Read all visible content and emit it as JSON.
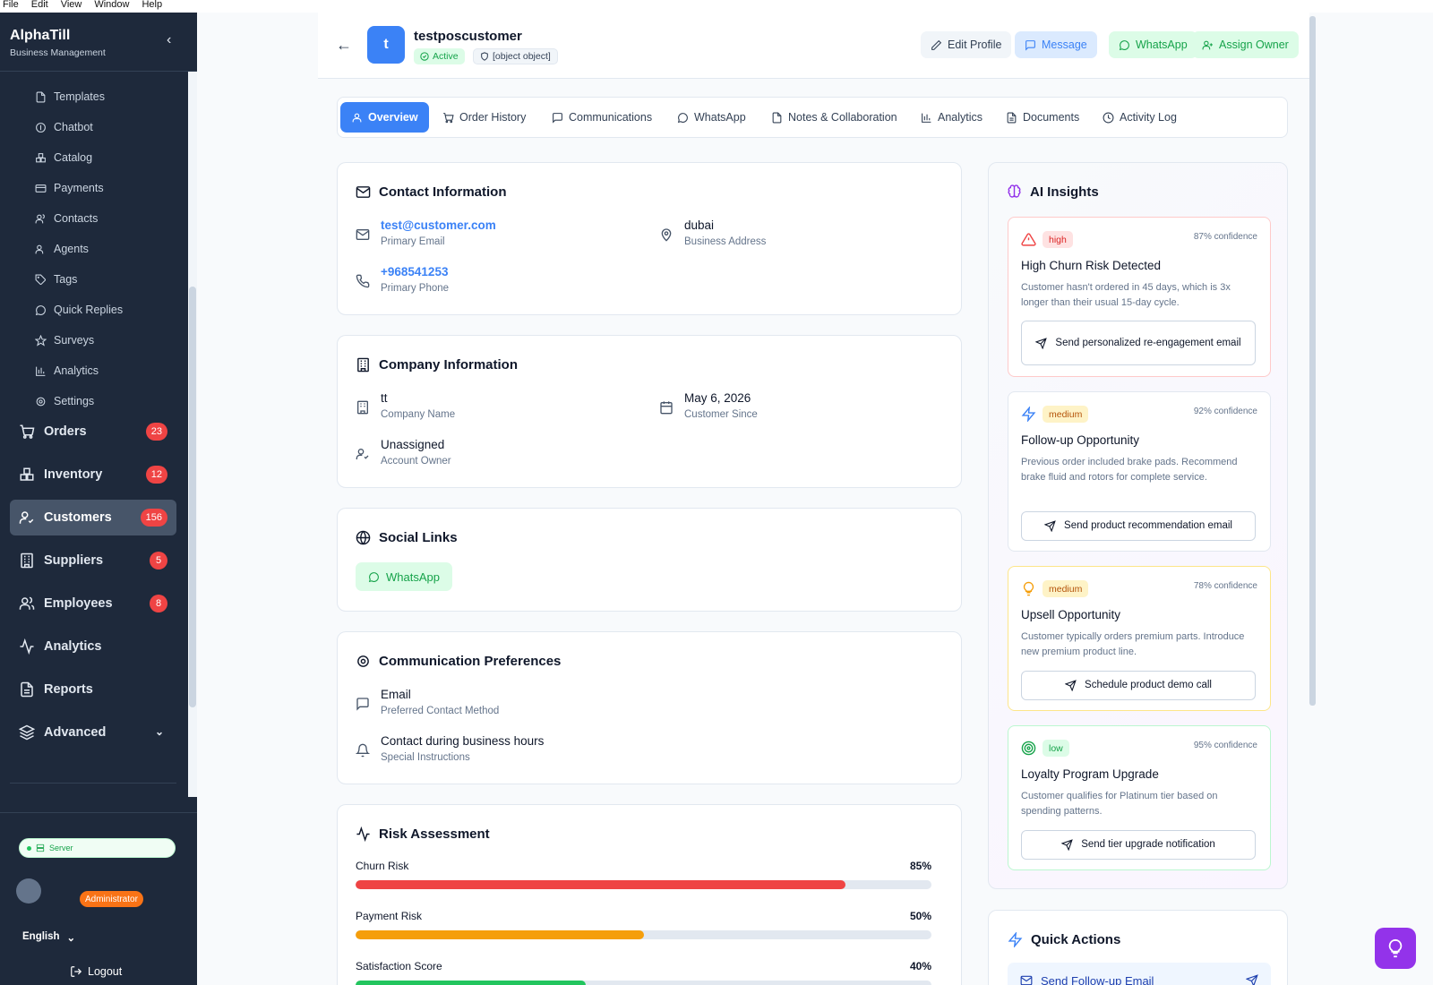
{
  "menubar": [
    "File",
    "Edit",
    "View",
    "Window",
    "Help"
  ],
  "sidebar": {
    "brand": "AlphaTill",
    "subtitle": "Business Management",
    "sub_items": [
      "Templates",
      "Chatbot",
      "Catalog",
      "Payments",
      "Contacts",
      "Agents",
      "Tags",
      "Quick Replies",
      "Surveys",
      "Analytics",
      "Settings"
    ],
    "main_items": [
      {
        "label": "Orders",
        "badge": "23"
      },
      {
        "label": "Inventory",
        "badge": "12"
      },
      {
        "label": "Customers",
        "badge": "156"
      },
      {
        "label": "Suppliers",
        "badge": "5"
      },
      {
        "label": "Employees",
        "badge": "8"
      },
      {
        "label": "Analytics"
      },
      {
        "label": "Reports"
      },
      {
        "label": "Advanced"
      }
    ],
    "server": "Server",
    "role": "Administrator",
    "language": "English",
    "logout": "Logout"
  },
  "header": {
    "avatar_letter": "t",
    "name": "testposcustomer",
    "status": "Active",
    "tag": "[object object]",
    "buttons": {
      "edit": "Edit Profile",
      "message": "Message",
      "whatsapp": "WhatsApp",
      "assign": "Assign Owner"
    }
  },
  "tabs": [
    "Overview",
    "Order History",
    "Communications",
    "WhatsApp",
    "Notes & Collaboration",
    "Analytics",
    "Documents",
    "Activity Log"
  ],
  "contact": {
    "title": "Contact Information",
    "email": "test@customer.com",
    "email_label": "Primary Email",
    "address": "dubai",
    "address_label": "Business Address",
    "phone": "+968541253",
    "phone_label": "Primary Phone"
  },
  "company": {
    "title": "Company Information",
    "name": "tt",
    "name_label": "Company Name",
    "since": "May 6, 2026",
    "since_label": "Customer Since",
    "owner": "Unassigned",
    "owner_label": "Account Owner"
  },
  "social": {
    "title": "Social Links",
    "whatsapp": "WhatsApp"
  },
  "prefs": {
    "title": "Communication Preferences",
    "method": "Email",
    "method_label": "Preferred Contact Method",
    "instructions": "Contact during business hours",
    "instructions_label": "Special Instructions"
  },
  "risk": {
    "title": "Risk Assessment",
    "rows": [
      {
        "label": "Churn Risk",
        "pct": "85%",
        "value": 0.85,
        "color": "#ef4444"
      },
      {
        "label": "Payment Risk",
        "pct": "50%",
        "value": 0.5,
        "color": "#f59e0b"
      },
      {
        "label": "Satisfaction Score",
        "pct": "40%",
        "value": 0.4,
        "color": "#22c55e"
      }
    ]
  },
  "ai": {
    "title": "AI Insights",
    "insights": [
      {
        "priority": "high",
        "confidence": "87% confidence",
        "title": "High Churn Risk Detected",
        "desc": "Customer hasn't ordered in 45 days, which is 3x longer than their usual 15-day cycle.",
        "action": "Send personalized re-engagement email"
      },
      {
        "priority": "medium",
        "confidence": "92% confidence",
        "title": "Follow-up Opportunity",
        "desc": "Previous order included brake pads. Recommend brake fluid and rotors for complete service.",
        "action": "Send product recommendation email"
      },
      {
        "priority": "medium",
        "confidence": "78% confidence",
        "title": "Upsell Opportunity",
        "desc": "Customer typically orders premium parts. Introduce new premium product line.",
        "action": "Schedule product demo call"
      },
      {
        "priority": "low",
        "confidence": "95% confidence",
        "title": "Loyalty Program Upgrade",
        "desc": "Customer qualifies for Platinum tier based on spending patterns.",
        "action": "Send tier upgrade notification"
      }
    ]
  },
  "quick_actions": {
    "title": "Quick Actions",
    "first": "Send Follow-up Email"
  }
}
